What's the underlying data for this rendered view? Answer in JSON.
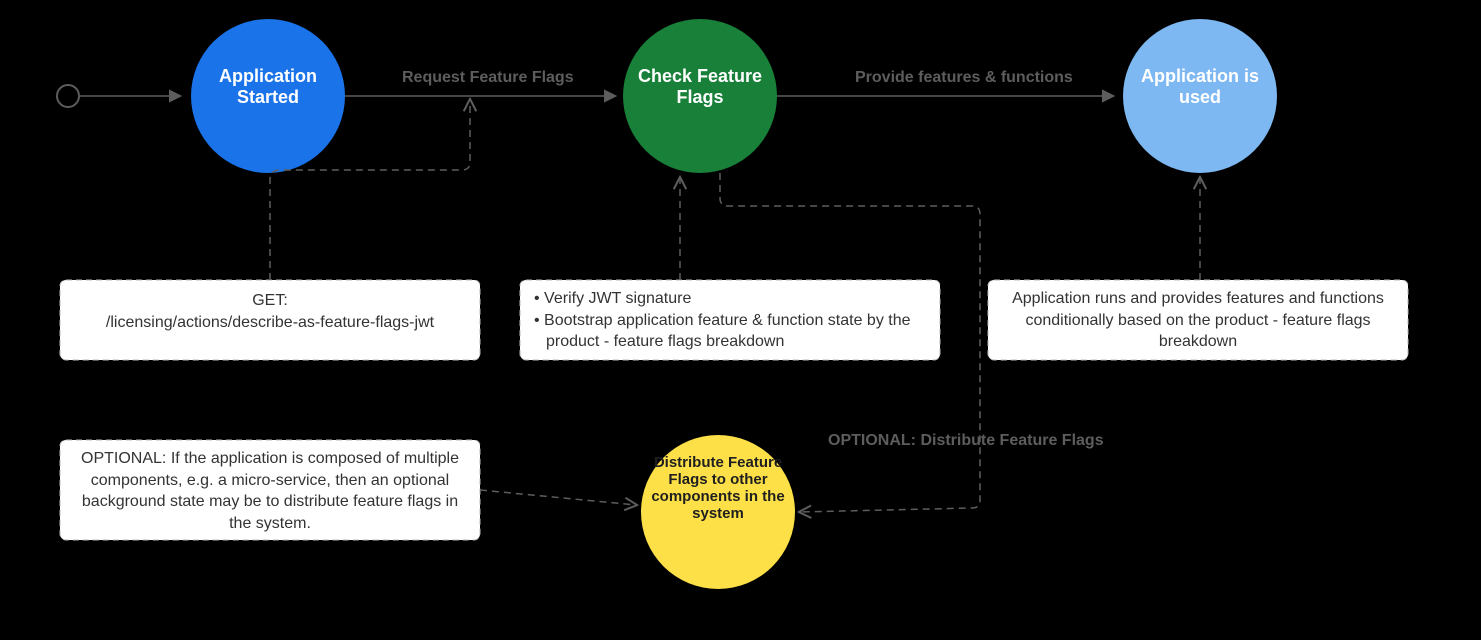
{
  "diagram": {
    "nodes": {
      "start": {
        "type": "initial"
      },
      "app_started": {
        "label": "Application Started",
        "type": "state",
        "color": "#1a73e8"
      },
      "check_flags": {
        "label": "Check Feature Flags",
        "type": "state",
        "color": "#188038"
      },
      "app_used": {
        "label": "Application is used",
        "type": "state",
        "color": "#7eb8f2"
      },
      "distribute": {
        "label": "Distribute Feature Flags to other components in the system",
        "type": "optional",
        "color": "#fde047"
      }
    },
    "edges": {
      "start_to_app": {
        "label": ""
      },
      "app_to_check": {
        "label": "Request Feature Flags"
      },
      "check_to_used": {
        "label": "Provide features & functions"
      },
      "check_to_dist": {
        "label": "OPTIONAL: Distribute Feature Flags"
      },
      "dist_to_check": {
        "label": ""
      }
    },
    "notes": {
      "note_api": {
        "line1": "GET:",
        "line2": "/licensing/actions/describe-as-feature-flags-jwt"
      },
      "note_check": {
        "bullet1": "Verify JWT signature",
        "bullet2": "Bootstrap application feature & function state by the product - feature flags breakdown"
      },
      "note_used": {
        "text": "Application runs and provides features and functions conditionally based on the product - feature flags breakdown"
      },
      "note_dist": {
        "text": "OPTIONAL: If the application is composed of multiple components, e.g. a micro-service, then an optional background state may be to distribute feature flags in the system."
      }
    }
  }
}
